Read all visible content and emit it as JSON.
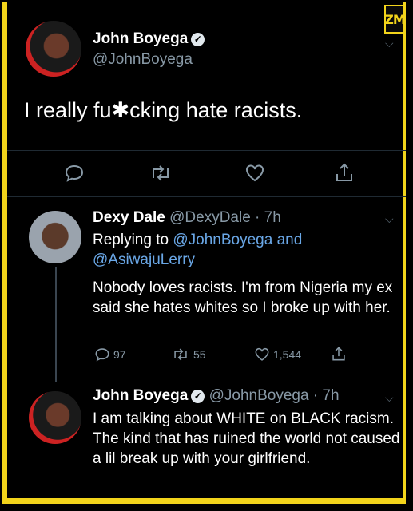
{
  "brand": {
    "logo_text": "ZM",
    "frame_color": "#f2d41b"
  },
  "main_tweet": {
    "name": "John Boyega",
    "handle": "@JohnBoyega",
    "text": "I really fu✱cking hate racists.",
    "actions": [
      "reply",
      "retweet",
      "like",
      "share"
    ]
  },
  "reply1": {
    "name": "Dexy Dale",
    "handle": "@DexyDale",
    "time": "7h",
    "replying_prefix": "Replying to",
    "replying_to_1": "@JohnBoyega",
    "replying_and": "and",
    "replying_to_2": "@AsiwajuLerry",
    "text": "Nobody loves racists. I'm from Nigeria my ex said she hates whites so I broke up with her.",
    "reply_count": "97",
    "retweet_count": "55",
    "like_count": "1,544"
  },
  "reply2": {
    "name": "John Boyega",
    "handle": "@JohnBoyega",
    "time": "7h",
    "text": "I am talking about WHITE on BLACK racism. The kind that has ruined the world not caused a lil break up with your girlfriend."
  },
  "colors": {
    "link": "#6aa7e6",
    "muted": "#8899a6"
  }
}
